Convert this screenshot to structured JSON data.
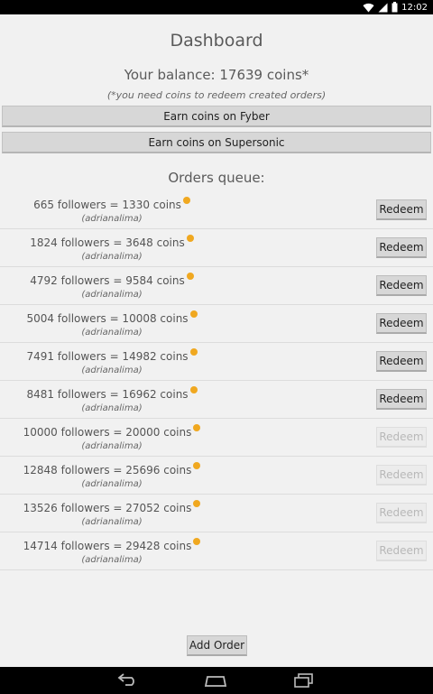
{
  "status_bar": {
    "time": "12:02"
  },
  "dashboard": {
    "title": "Dashboard",
    "balance": "Your balance: 17639 coins*",
    "balance_note": "(*you need coins to redeem created orders)",
    "earn_fyber_label": "Earn coins on Fyber",
    "earn_supersonic_label": "Earn coins on Supersonic",
    "orders_title": "Orders queue:"
  },
  "orders": [
    {
      "text": "665 followers = 1330 coins",
      "user": "(adrianalima)",
      "redeem": "Redeem",
      "enabled": true
    },
    {
      "text": "1824 followers = 3648 coins",
      "user": "(adrianalima)",
      "redeem": "Redeem",
      "enabled": true
    },
    {
      "text": "4792 followers = 9584 coins",
      "user": "(adrianalima)",
      "redeem": "Redeem",
      "enabled": true
    },
    {
      "text": "5004 followers = 10008 coins",
      "user": "(adrianalima)",
      "redeem": "Redeem",
      "enabled": true
    },
    {
      "text": "7491 followers = 14982 coins",
      "user": "(adrianalima)",
      "redeem": "Redeem",
      "enabled": true
    },
    {
      "text": "8481 followers = 16962 coins",
      "user": "(adrianalima)",
      "redeem": "Redeem",
      "enabled": true
    },
    {
      "text": "10000 followers = 20000 coins",
      "user": "(adrianalima)",
      "redeem": "Redeem",
      "enabled": false
    },
    {
      "text": "12848 followers = 25696 coins",
      "user": "(adrianalima)",
      "redeem": "Redeem",
      "enabled": false
    },
    {
      "text": "13526 followers = 27052 coins",
      "user": "(adrianalima)",
      "redeem": "Redeem",
      "enabled": false
    },
    {
      "text": "14714 followers = 29428 coins",
      "user": "(adrianalima)",
      "redeem": "Redeem",
      "enabled": false
    }
  ],
  "add_order_label": "Add Order",
  "colors": {
    "coin": "#f0a820",
    "status_bar": "#000000",
    "background": "#f1f1f1"
  },
  "icons": {
    "wifi": "wifi-icon",
    "signal": "signal-icon",
    "battery": "battery-icon",
    "back": "back-icon",
    "home": "home-icon",
    "recents": "recents-icon",
    "coin": "coin-icon"
  }
}
